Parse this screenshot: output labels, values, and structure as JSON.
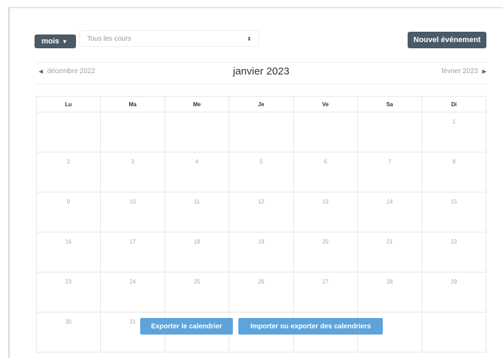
{
  "toolbar": {
    "view_label": "mois",
    "course_filter": "Tous les cours",
    "new_event_label": "Nouvel événement"
  },
  "nav": {
    "prev_label": "décembre 2022",
    "current_month": "janvier 2023",
    "next_label": "février 2023"
  },
  "calendar": {
    "weekdays": [
      "Lu",
      "Ma",
      "Me",
      "Je",
      "Ve",
      "Sa",
      "Di"
    ],
    "weeks": [
      [
        "",
        "",
        "",
        "",
        "",
        "",
        "1"
      ],
      [
        "2",
        "3",
        "4",
        "5",
        "6",
        "7",
        "8"
      ],
      [
        "9",
        "10",
        "11",
        "12",
        "13",
        "14",
        "15"
      ],
      [
        "16",
        "17",
        "18",
        "19",
        "20",
        "21",
        "22"
      ],
      [
        "23",
        "24",
        "25",
        "26",
        "27",
        "28",
        "29"
      ],
      [
        "30",
        "31",
        "",
        "",
        "",
        "",
        ""
      ]
    ]
  },
  "footer": {
    "export_label": "Exporter le calendrier",
    "import_export_label": "Importer ou exporter des calendriers"
  }
}
